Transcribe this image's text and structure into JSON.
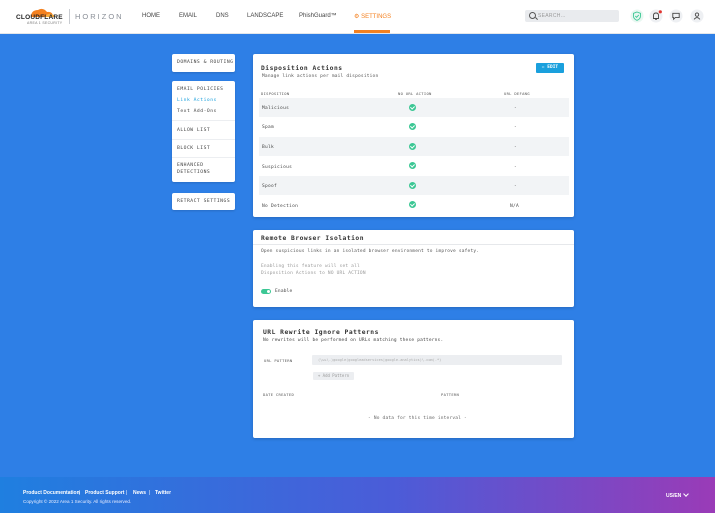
{
  "brand": {
    "name": "CLOUDFLARE",
    "sub": "AREA 1 SECURITY",
    "product": "HORIZON"
  },
  "nav": [
    {
      "label": "HOME"
    },
    {
      "label": "EMAIL"
    },
    {
      "label": "DNS"
    },
    {
      "label": "LANDSCAPE"
    },
    {
      "label": "PhishGuard™"
    },
    {
      "label": "SETTINGS",
      "icon": "gear-icon",
      "active": true
    }
  ],
  "search": {
    "placeholder": "SEARCH..."
  },
  "topbar_icons": [
    "shield-check-icon",
    "notification-bell-icon",
    "chat-bubble-icon",
    "user-icon"
  ],
  "sidebar": {
    "top": "DOMAINS & ROUTING",
    "email_policies": "EMAIL POLICIES",
    "link_actions": "Link Actions",
    "text_addons": "Text Add-Ons",
    "allow_list": "ALLOW LIST",
    "block_list": "BLOCK LIST",
    "enhanced_line1": "ENHANCED",
    "enhanced_line2": "DETECTIONS",
    "retract": "RETRACT SETTINGS"
  },
  "disposition": {
    "title": "Disposition Actions",
    "subtitle": "Manage link actions per mail disposition",
    "edit_label": "✏ EDIT",
    "headers": [
      "DISPOSITION",
      "NO URL ACTION",
      "URL DEFANG"
    ],
    "rows": [
      {
        "name": "Malicious",
        "no_url_action": true,
        "defang": "-"
      },
      {
        "name": "Spam",
        "no_url_action": true,
        "defang": "-"
      },
      {
        "name": "Bulk",
        "no_url_action": true,
        "defang": "-"
      },
      {
        "name": "Suspicious",
        "no_url_action": true,
        "defang": "-"
      },
      {
        "name": "Spoof",
        "no_url_action": true,
        "defang": "-"
      },
      {
        "name": "No Detection",
        "no_url_action": true,
        "defang": "N/A"
      }
    ]
  },
  "rbi": {
    "title": "Remote Browser Isolation",
    "description": "Open suspicious links in an isolated browser environment to improve safety.",
    "note1": "Enabling this feature will set all",
    "note2": "Disposition Actions to NO URL ACTION",
    "toggle_label": "Enable",
    "enabled": true
  },
  "rewrite": {
    "title": "URL Rewrite Ignore Patterns",
    "subtitle": "No rewrites will be performed on URLs matching these patterns.",
    "field_label": "URL PATTERN",
    "placeholder": "(\\w+\\.)google(googleadservices|google-analytics)\\.com(.*)",
    "add_label": "+ Add Pattern",
    "col_date": "DATE CREATED",
    "col_pattern": "PATTERN",
    "empty": "- No data for this time interval -"
  },
  "footer": {
    "links": [
      "Product Documentation",
      "Product Support",
      "News",
      "Twitter"
    ],
    "separator": "|",
    "copyright": "Copyright © 2022 Area 1 Security. All rights reserved.",
    "locale": "US/EN"
  },
  "colors": {
    "accent": "#f48120",
    "primary": "#1aa0dd",
    "success": "#3cc794",
    "background": "#2e7fe6"
  }
}
